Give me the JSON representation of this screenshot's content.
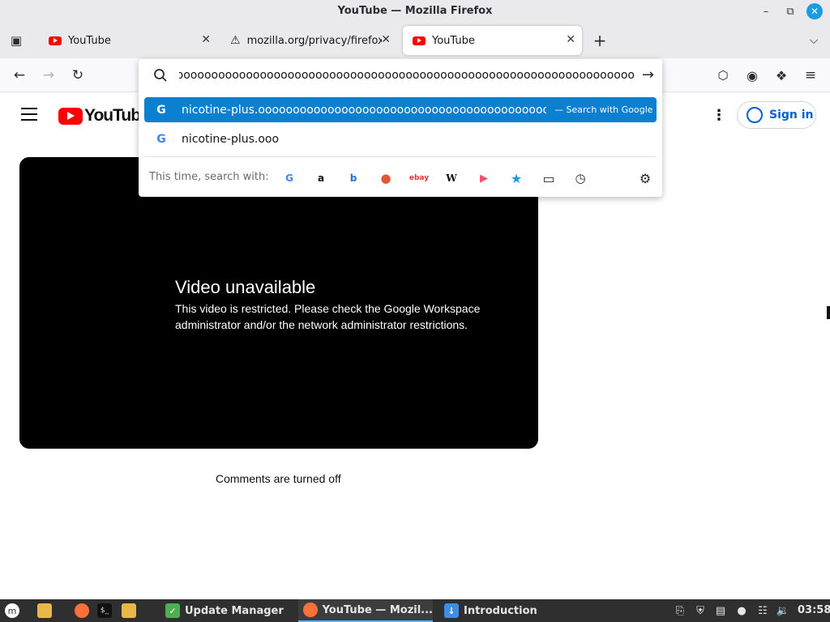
{
  "window": {
    "title": "YouTube — Mozilla Firefox"
  },
  "tabs": [
    {
      "label": "YouTube",
      "icon": "youtube-icon"
    },
    {
      "label": "mozilla.org/privacy/firefox/",
      "icon": "warning-icon"
    },
    {
      "label": "YouTube",
      "icon": "youtube-icon",
      "active": true
    }
  ],
  "urlbar": {
    "value": "nicotine-plus.ooooooooooooooooooooooooooooooooooooooooooooooooooooooooooooooooooooooo",
    "suggestions": [
      {
        "text": "nicotine-plus.ooooooooooooooooooooooooooooooooooooooooooooooooooooooooo",
        "action": "— Search with Google",
        "selected": true
      },
      {
        "text": "nicotine-plus.ooo",
        "action": "",
        "selected": false
      }
    ],
    "search_with_label": "This time, search with:",
    "engines": [
      "google-icon",
      "amazon-icon",
      "bing-icon",
      "duckduckgo-icon",
      "ebay-icon",
      "wikipedia-icon",
      "youtube-icon",
      "bookmarks-icon",
      "tabs-icon",
      "history-icon"
    ]
  },
  "youtube": {
    "logo_text": "YouTube",
    "sign_in": "Sign in",
    "video_title": "Video unavailable",
    "video_message": "This video is restricted. Please check the Google Workspace administrator and/or the network administrator restrictions.",
    "comments": "Comments are turned off"
  },
  "taskbar": {
    "tasks": [
      {
        "label": "Update Manager",
        "icon": "shield-icon"
      },
      {
        "label": "YouTube — Mozil...",
        "icon": "firefox-icon",
        "active": true
      },
      {
        "label": "Introduction",
        "icon": "download-icon"
      }
    ],
    "clock": "03:58"
  },
  "colors": {
    "accent": "#0b7fd0",
    "youtube_red": "#ff0000",
    "signin_blue": "#065fd4",
    "taskbar_bg": "#2f2f2f"
  }
}
